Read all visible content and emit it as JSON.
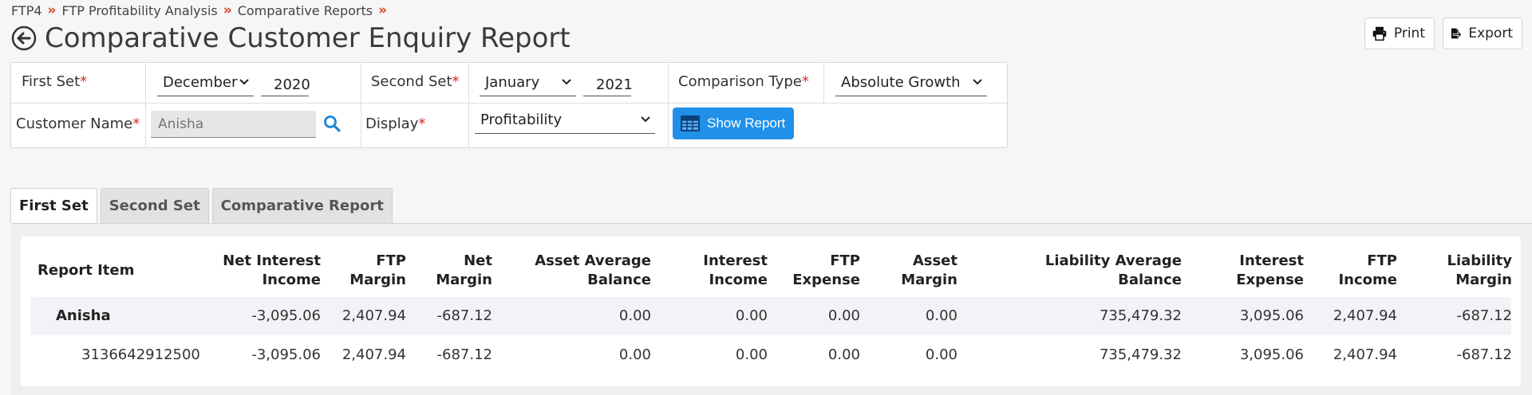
{
  "breadcrumb": [
    "FTP4",
    "FTP Profitability Analysis",
    "Comparative Reports"
  ],
  "page_title": "Comparative Customer Enquiry Report",
  "buttons": {
    "print": "Print",
    "export": "Export",
    "show_report": "Show Report"
  },
  "filters": {
    "first_set": {
      "label": "First Set",
      "month": "December",
      "year": "2020"
    },
    "second_set": {
      "label": "Second Set",
      "month": "January",
      "year": "2021"
    },
    "comparison_type": {
      "label": "Comparison Type",
      "value": "Absolute Growth"
    },
    "customer_name": {
      "label": "Customer Name",
      "placeholder": "Anisha"
    },
    "display": {
      "label": "Display",
      "value": "Profitability"
    },
    "required_mark": "*"
  },
  "tabs": [
    "First Set",
    "Second Set",
    "Comparative Report"
  ],
  "table": {
    "headers": [
      [
        "Report Item"
      ],
      [
        "Net Interest",
        "Income"
      ],
      [
        "FTP",
        "Margin"
      ],
      [
        "Net",
        "Margin"
      ],
      [
        "Asset Average",
        "Balance"
      ],
      [
        "Interest",
        "Income"
      ],
      [
        "FTP",
        "Expense"
      ],
      [
        "Asset",
        "Margin"
      ],
      [
        "Liability Average",
        "Balance"
      ],
      [
        "Interest",
        "Expense"
      ],
      [
        "FTP",
        "Income"
      ],
      [
        "Liability",
        "Margin"
      ]
    ],
    "rows": [
      [
        "Anisha",
        "-3,095.06",
        "2,407.94",
        "-687.12",
        "0.00",
        "0.00",
        "0.00",
        "0.00",
        "735,479.32",
        "3,095.06",
        "2,407.94",
        "-687.12"
      ],
      [
        "3136642912500",
        "-3,095.06",
        "2,407.94",
        "-687.12",
        "0.00",
        "0.00",
        "0.00",
        "0.00",
        "735,479.32",
        "3,095.06",
        "2,407.94",
        "-687.12"
      ]
    ]
  },
  "colors": {
    "accent": "#2090e8",
    "required": "#d62a1f",
    "breadcrumb_sep": "#d9441c"
  },
  "icons": {
    "back": "arrow-left-circle-icon",
    "print": "printer-icon",
    "export": "file-export-icon",
    "search": "search-icon",
    "show_report": "table-grid-icon",
    "chevron": "chevron-down-icon"
  }
}
